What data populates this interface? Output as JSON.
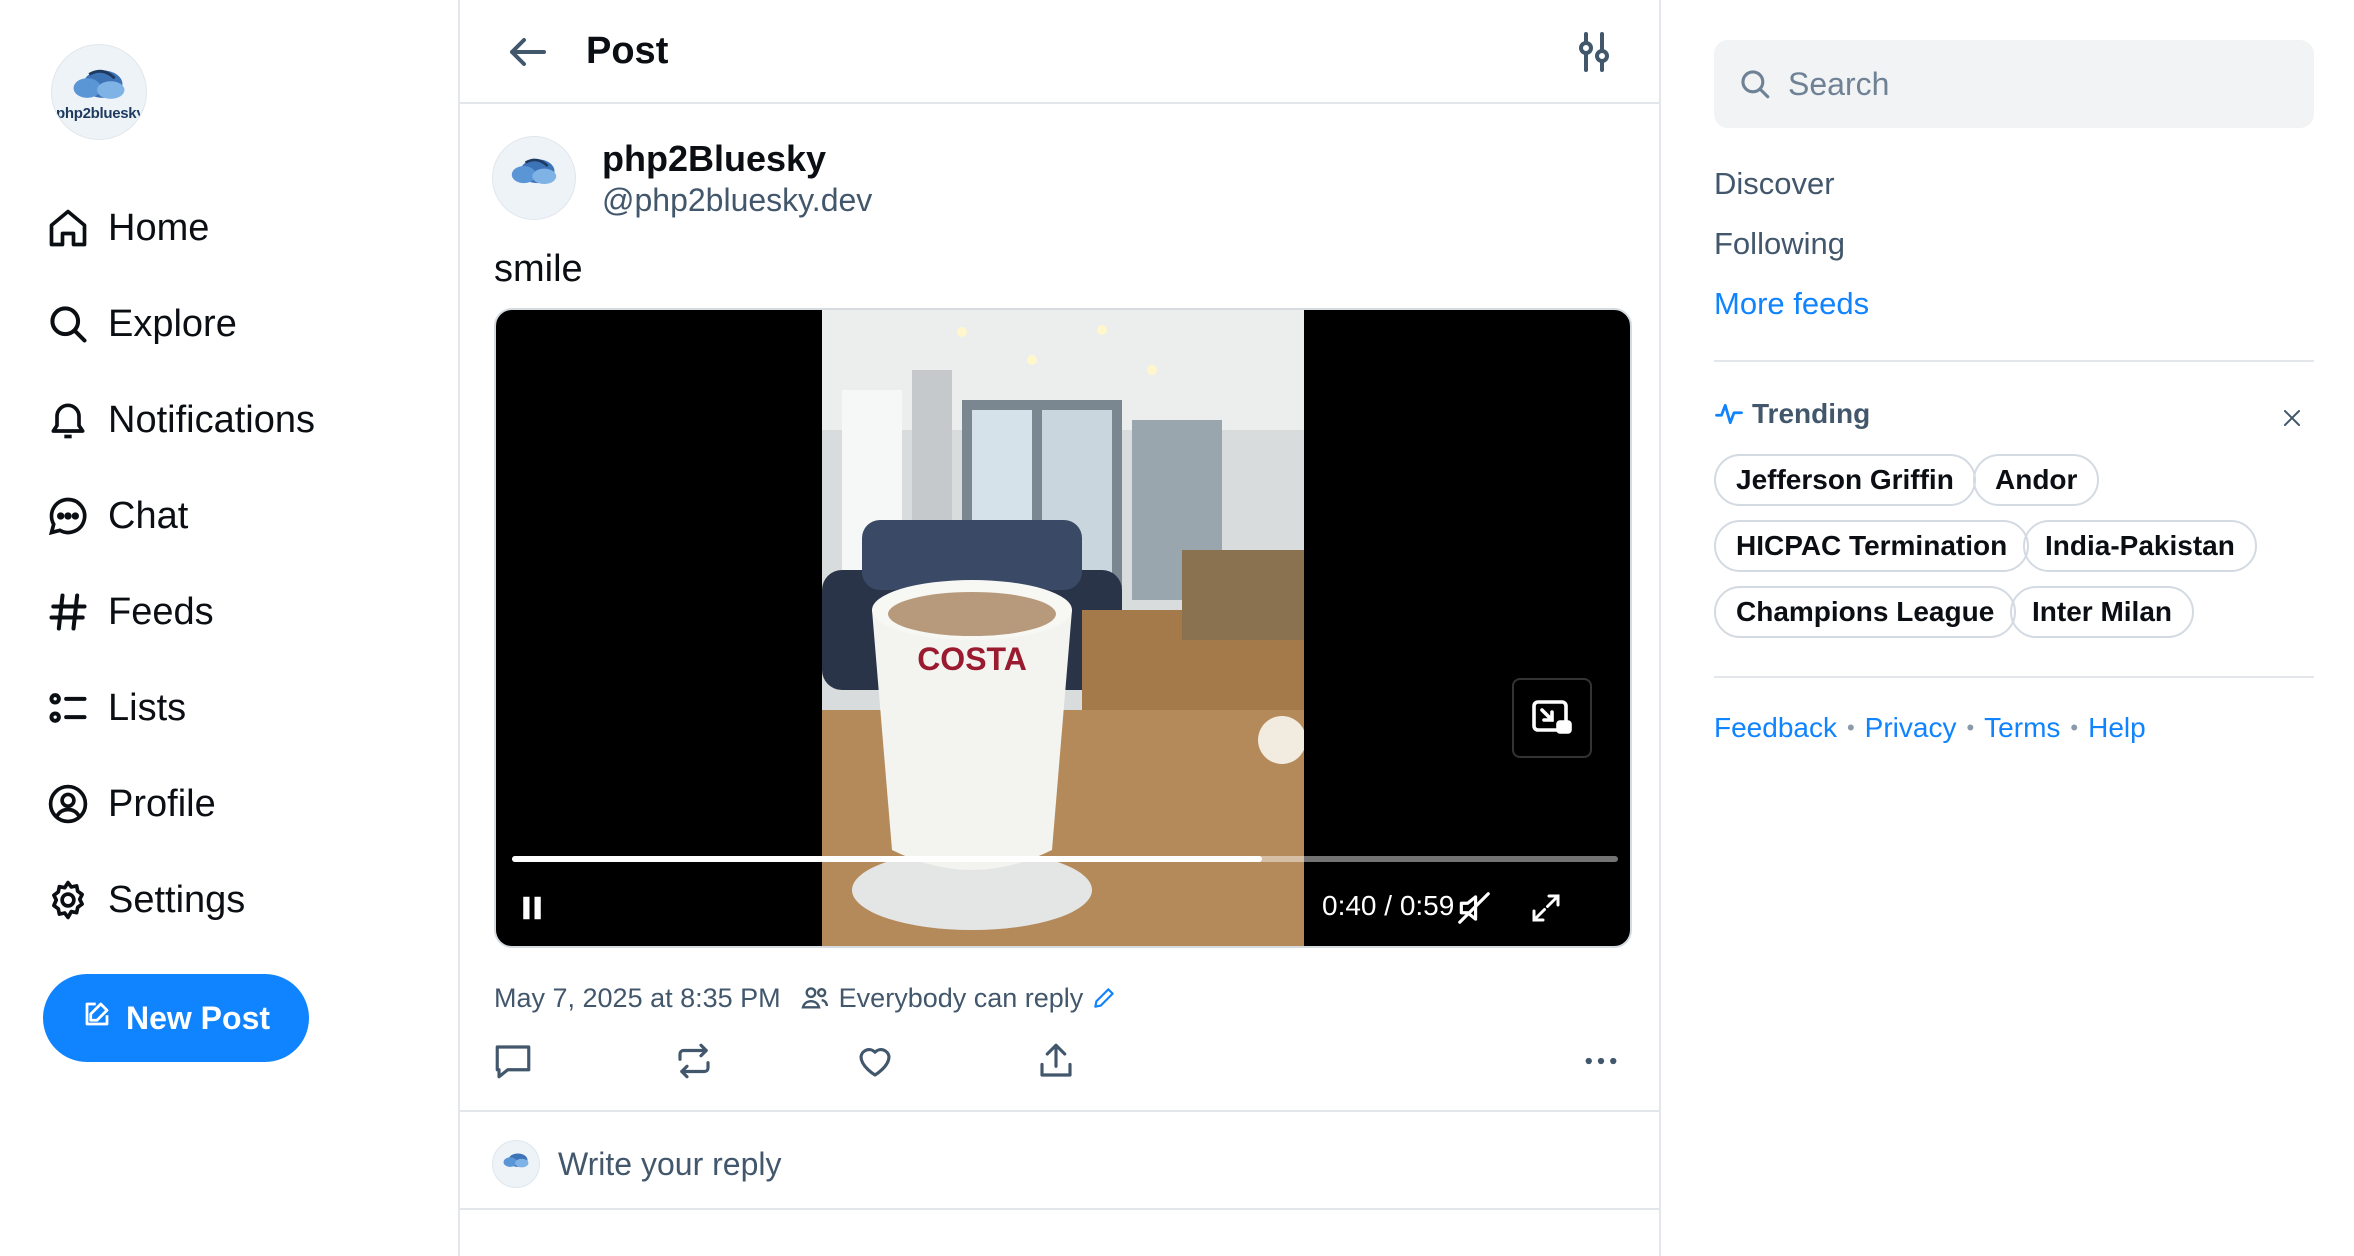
{
  "app": {
    "logo_text": "php2bluesky"
  },
  "nav": {
    "items": [
      {
        "label": "Home",
        "icon": "home-icon"
      },
      {
        "label": "Explore",
        "icon": "search-icon"
      },
      {
        "label": "Notifications",
        "icon": "bell-icon"
      },
      {
        "label": "Chat",
        "icon": "chat-icon"
      },
      {
        "label": "Feeds",
        "icon": "hash-icon"
      },
      {
        "label": "Lists",
        "icon": "list-icon"
      },
      {
        "label": "Profile",
        "icon": "user-circle-icon"
      },
      {
        "label": "Settings",
        "icon": "gear-icon"
      }
    ],
    "new_post_label": "New Post"
  },
  "header": {
    "title": "Post"
  },
  "post": {
    "author_name": "php2Bluesky",
    "author_handle": "@php2bluesky.dev",
    "text": "smile",
    "timestamp": "May 7, 2025 at 8:35 PM",
    "reply_setting": "Everybody can reply",
    "video": {
      "current_time": "0:40",
      "duration": "0:59",
      "time_display": "0:40 / 0:59",
      "progress": 0.678,
      "state": "playing",
      "muted": true
    }
  },
  "reply": {
    "placeholder": "Write your reply"
  },
  "search": {
    "placeholder": "Search"
  },
  "feeds": {
    "discover": "Discover",
    "following": "Following",
    "more": "More feeds"
  },
  "trending": {
    "title": "Trending",
    "topics": [
      "Jefferson Griffin",
      "Andor",
      "HICPAC Termination",
      "India-Pakistan",
      "Champions League",
      "Inter Milan"
    ]
  },
  "footer": {
    "links": [
      "Feedback",
      "Privacy",
      "Terms",
      "Help"
    ]
  },
  "colors": {
    "accent": "#1083fe",
    "text_primary": "#0b0f14",
    "text_secondary": "#42576c",
    "border": "#e3e7ec"
  }
}
